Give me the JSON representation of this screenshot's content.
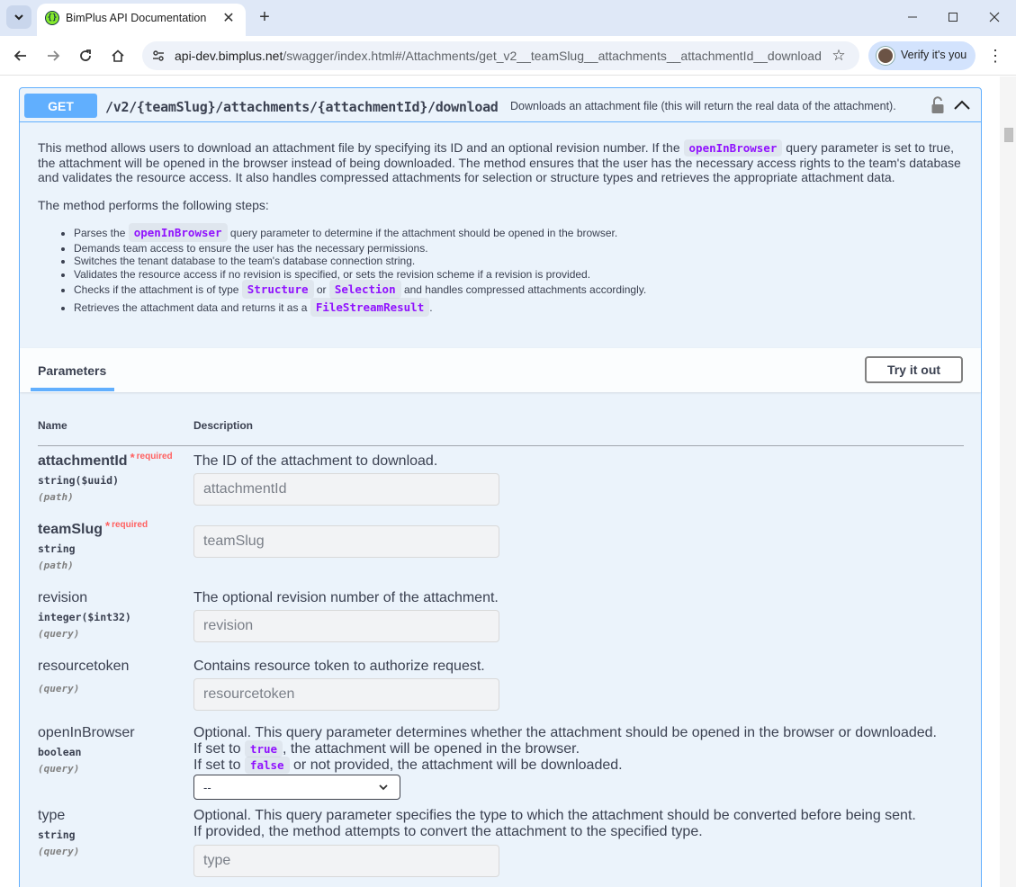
{
  "browser": {
    "tab_title": "BimPlus API Documentation",
    "url_host": "api-dev.bimplus.net",
    "url_path": "/swagger/index.html#/Attachments/get_v2__teamSlug__attachments__attachmentId__download",
    "verify_label": "Verify it's you"
  },
  "operation": {
    "method": "GET",
    "path": "/v2/{teamSlug}/attachments/{attachmentId}/download",
    "summary": "Downloads an attachment file (this will return the real data of the attachment).",
    "intro_part1": "This method allows users to download an attachment file by specifying its ID and an optional revision number. If the",
    "intro_code": "openInBrowser",
    "intro_part2": "query parameter is set to true, the attachment will be opened in the browser instead of being downloaded. The method ensures that the user has the necessary access rights to the team's database and validates the resource access. It also handles compressed attachments for selection or structure types and retrieves the appropriate attachment data.",
    "steps_intro": "The method performs the following steps:",
    "steps": {
      "s1_pre": "Parses the",
      "s1_code": "openInBrowser",
      "s1_post": "query parameter to determine if the attachment should be opened in the browser.",
      "s2": "Demands team access to ensure the user has the necessary permissions.",
      "s3": "Switches the tenant database to the team's database connection string.",
      "s4": "Validates the resource access if no revision is specified, or sets the revision scheme if a revision is provided.",
      "s5_pre": "Checks if the attachment is of type",
      "s5_code1": "Structure",
      "s5_mid": "or",
      "s5_code2": "Selection",
      "s5_post": "and handles compressed attachments accordingly.",
      "s6_pre": "Retrieves the attachment data and returns it as a",
      "s6_code": "FileStreamResult",
      "s6_post": "."
    }
  },
  "parameters": {
    "tab_label": "Parameters",
    "try_label": "Try it out",
    "col_name": "Name",
    "col_desc": "Description",
    "required_star": "*",
    "required_label": "required",
    "items": [
      {
        "name": "attachmentId",
        "type": "string($uuid)",
        "in": "(path)",
        "description": "The ID of the attachment to download.",
        "placeholder": "attachmentId"
      },
      {
        "name": "teamSlug",
        "type": "string",
        "in": "(path)",
        "description": "",
        "placeholder": "teamSlug"
      },
      {
        "name": "revision",
        "type": "integer($int32)",
        "in": "(query)",
        "description": "The optional revision number of the attachment.",
        "placeholder": "revision"
      },
      {
        "name": "resourcetoken",
        "type": "",
        "in": "(query)",
        "description": "Contains resource token to authorize request.",
        "placeholder": "resourcetoken"
      },
      {
        "name": "openInBrowser",
        "type": "boolean",
        "in": "(query)",
        "desc_line1": "Optional. This query parameter determines whether the attachment should be opened in the browser or downloaded.",
        "desc_line2_pre": "If set to",
        "desc_line2_code": "true",
        "desc_line2_post": ", the attachment will be opened in the browser.",
        "desc_line3_pre": "If set to",
        "desc_line3_code": "false",
        "desc_line3_post": "or not provided, the attachment will be downloaded.",
        "select_value": "--"
      },
      {
        "name": "type",
        "type": "string",
        "in": "(query)",
        "desc_line1": "Optional. This query parameter specifies the type to which the attachment should be converted before being sent.",
        "desc_line2": "If provided, the method attempts to convert the attachment to the specified type.",
        "placeholder": "type"
      }
    ]
  },
  "colors": {
    "get_blue": "#61affe",
    "opblock_bg": "#ebf3fb",
    "code_purple": "#9012fe",
    "required_red": "#ff6060"
  }
}
